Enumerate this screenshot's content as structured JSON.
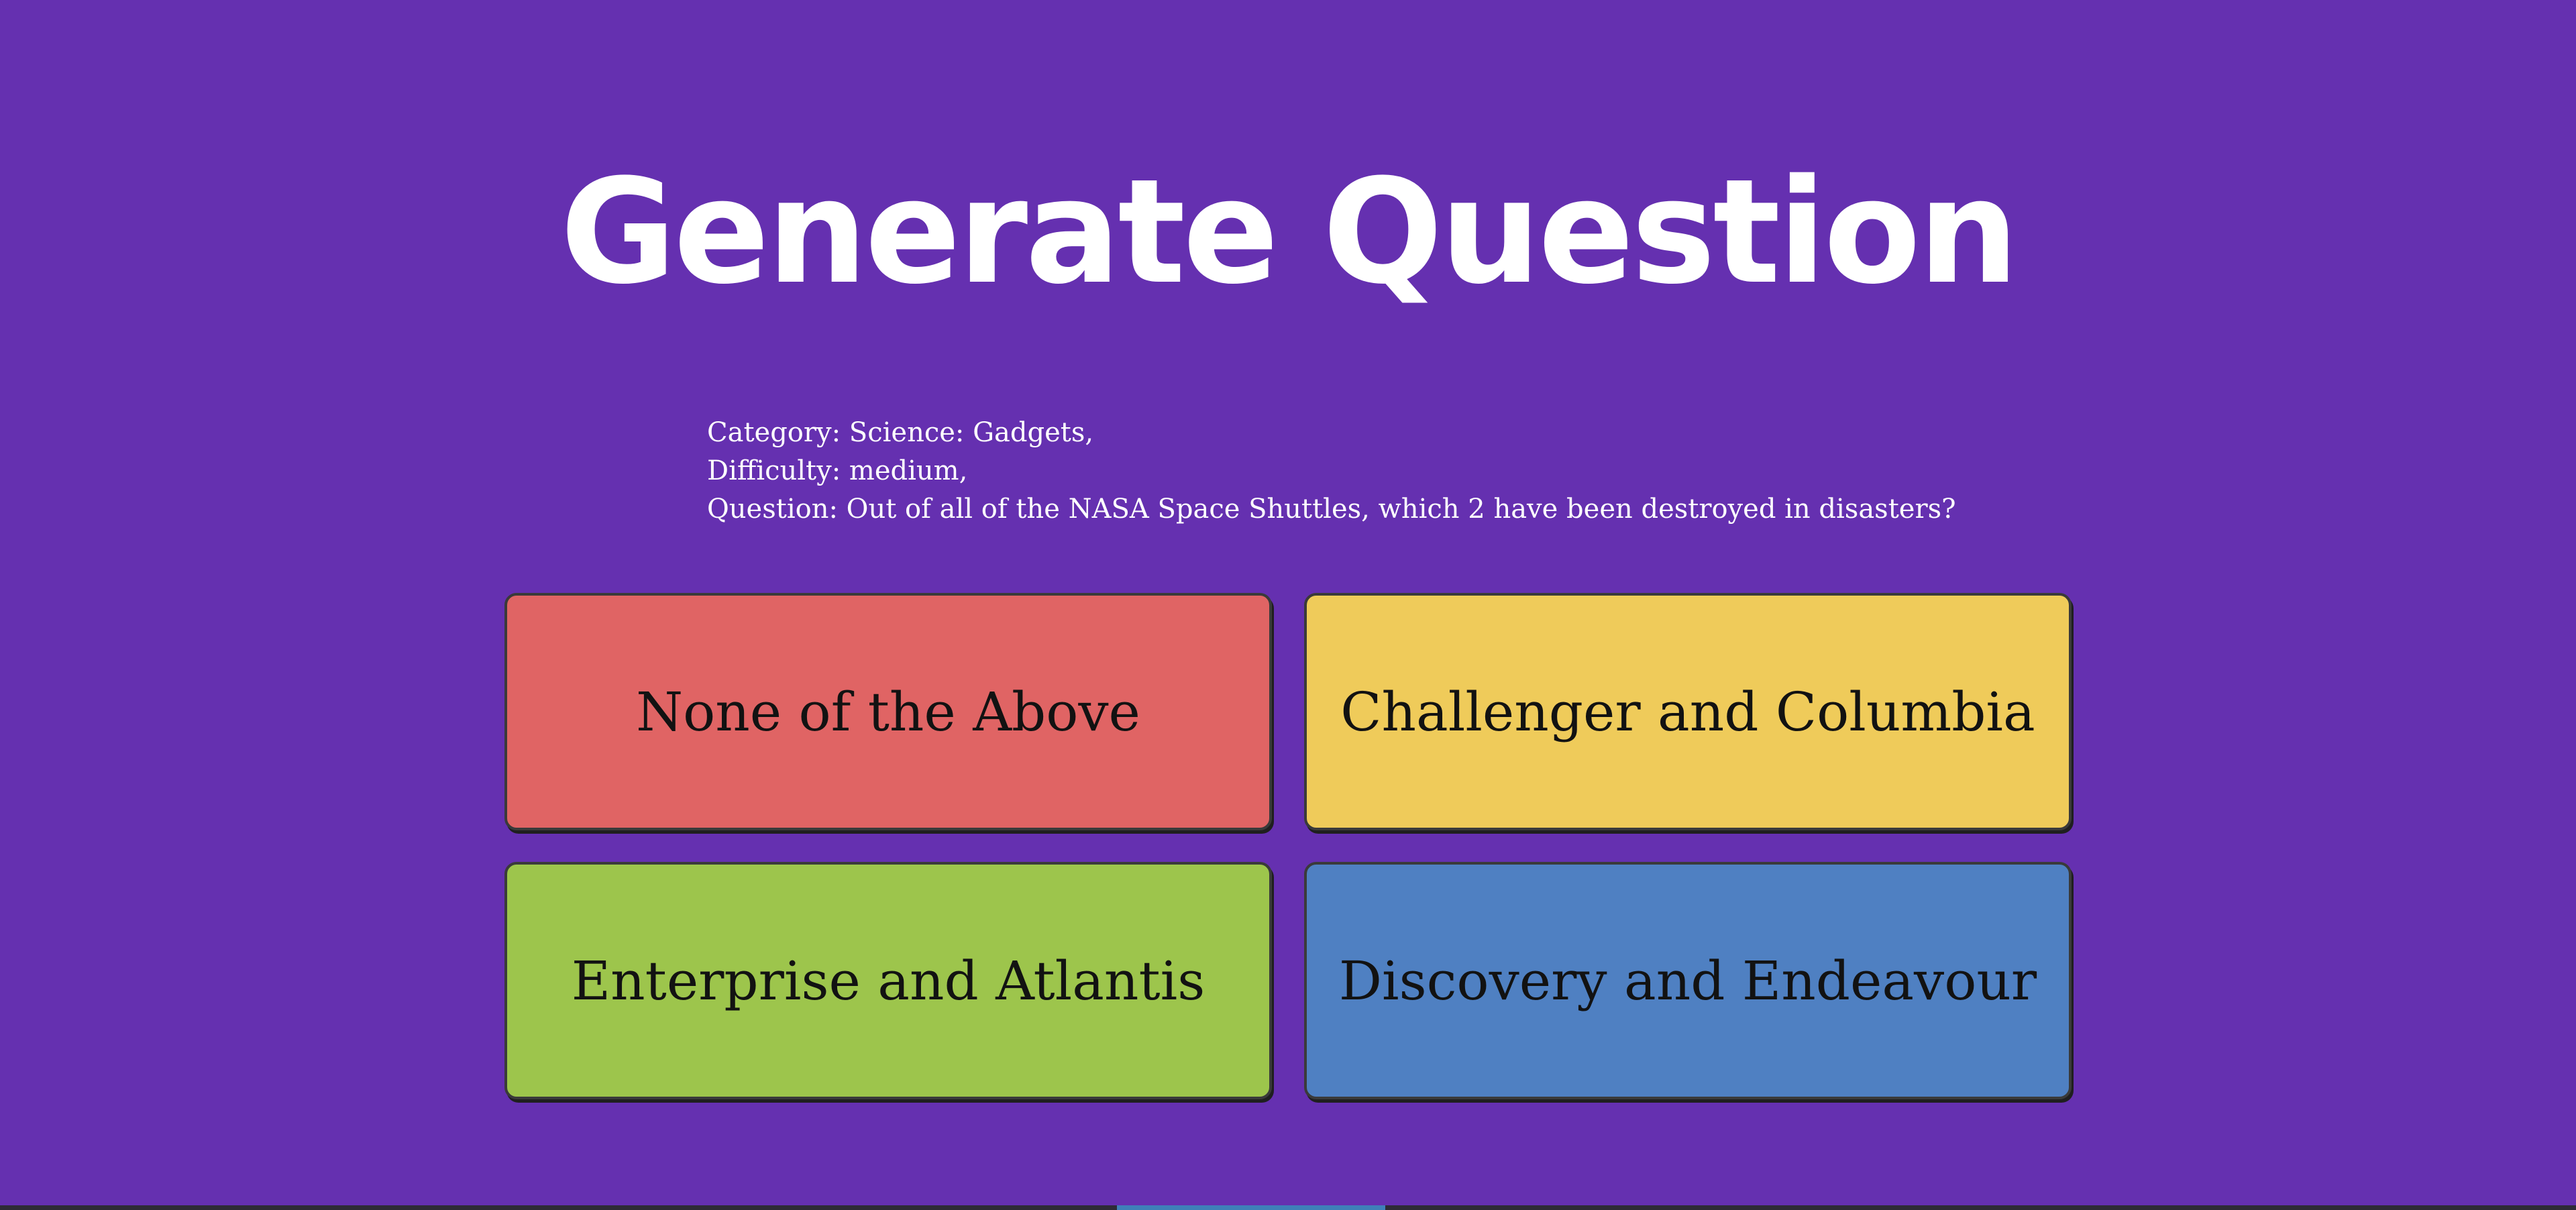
{
  "title": "Generate Question",
  "info": {
    "category": "Category: Science: Gadgets,",
    "difficulty": "Difficulty: medium,",
    "question": "Question: Out of all of the NASA Space Shuttles, which 2 have been destroyed in disasters?"
  },
  "answers": [
    {
      "label": "None of the Above",
      "color": "#e06464"
    },
    {
      "label": "Challenger and Columbia",
      "color": "#efcb5a"
    },
    {
      "label": "Enterprise and Atlantis",
      "color": "#9dc54c"
    },
    {
      "label": "Discovery and Endeavour",
      "color": "#4f80c2"
    }
  ],
  "colors": {
    "background": "#6530b0",
    "title_text": "#ffffff",
    "answer_text": "#121212"
  }
}
